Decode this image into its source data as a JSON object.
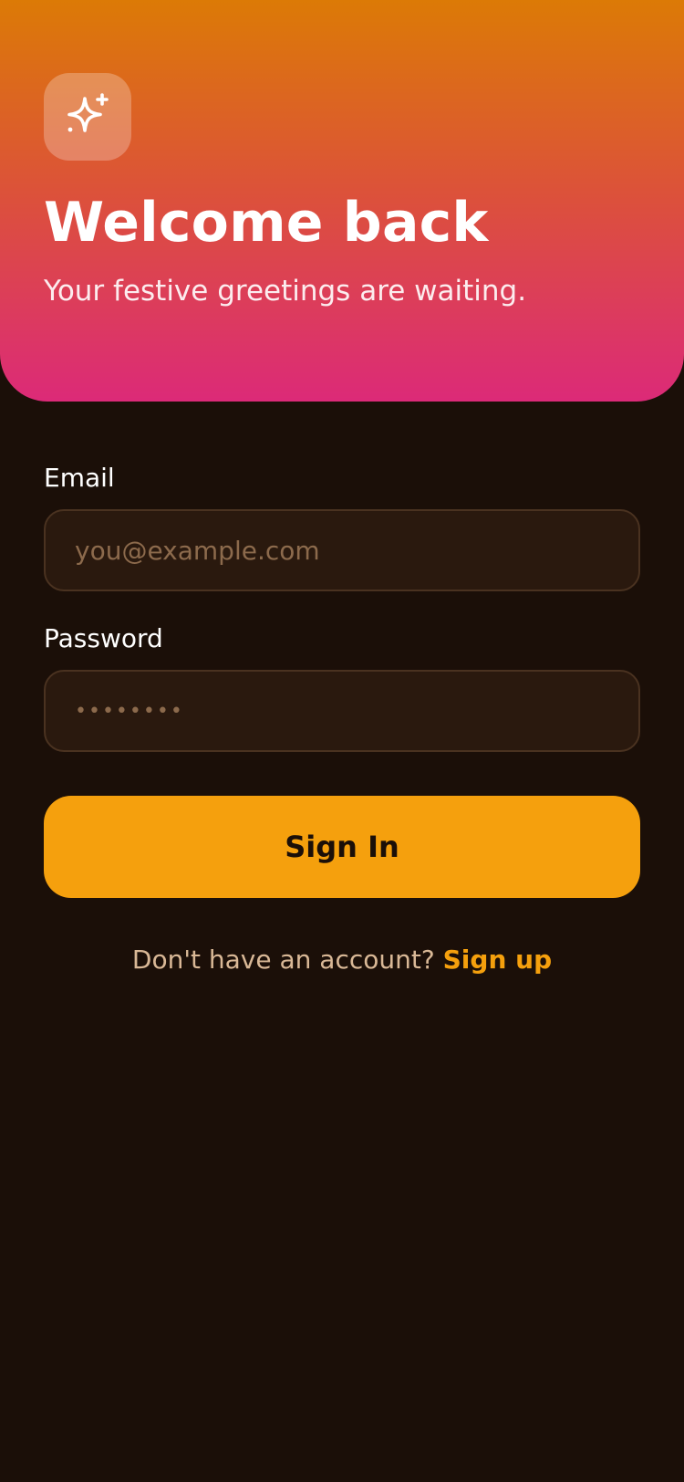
{
  "header": {
    "icon": "sparkles-icon",
    "title": "Welcome back",
    "subtitle": "Your festive greetings are waiting."
  },
  "form": {
    "email": {
      "label": "Email",
      "placeholder": "you@example.com",
      "value": ""
    },
    "password": {
      "label": "Password",
      "masked_value": "••••••••"
    },
    "submit_label": "Sign In"
  },
  "footer": {
    "prompt": "Don't have an account?",
    "link_label": "Sign up"
  },
  "colors": {
    "gradient_top": "#dc7a06",
    "gradient_bottom": "#dc2a78",
    "accent": "#f5a00d",
    "background": "#1b0f08",
    "field_background": "#2a190e"
  }
}
